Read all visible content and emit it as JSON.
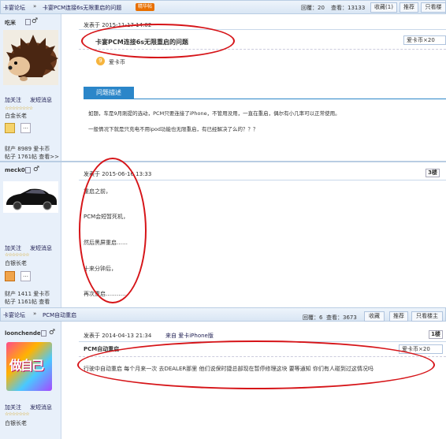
{
  "topbar": {
    "crumb1": "卡宴论坛",
    "sep": "»",
    "crumb2": "卡宴PCM连接6s无限重启的问题",
    "badge": "精华帖",
    "reply_label": "回覆：",
    "reply_count": "20",
    "view_label": "查看：",
    "view_count": "13133",
    "fav": "收藏(1)",
    "recommend": "推荐",
    "only_owner": "只看楼"
  },
  "post1": {
    "user": "吃米",
    "date": "发表于 2015-11-17 14:02",
    "title": "卡宴PCM连接6s无限重启的问题",
    "currency": "爱卡币×20",
    "coin": "9",
    "coin_label": "爱卡币",
    "section": "问题描述",
    "line1": "如题，车是9月刚提的选动，PCM只要连接了iPhone，不管用没用，一直在重启，偶尔有小几率可以正常使用。",
    "line2": "一般情况下就是只充电不用ipod功能也无限重启，有已经解决了么的？？？",
    "follow": "加关注",
    "msg": "发短消息",
    "rank": "白金长老",
    "money_label": "财产",
    "money": "8989 爱卡币",
    "posts_label": "帖子",
    "posts": "1761帖 查看>>",
    "stars": "☆☆☆☆☆☆☆☆"
  },
  "post2": {
    "user": "meck0",
    "date": "发表于 2015-06-16 13:33",
    "floor": "3楼",
    "follow": "加关注",
    "msg": "发短消息",
    "rank": "白银长老",
    "money_label": "财产",
    "money": "1411 爱卡币",
    "posts_label": "帖子",
    "posts": "1161帖 查看",
    "stars": "☆☆☆☆☆☆☆",
    "l1": "重启之前，",
    "l2": "PCM会短暂死机，",
    "l3": "然后黑屏重启……",
    "l4": "十来分钟后，",
    "l5": "再次重启…………"
  },
  "topbar2": {
    "crumb1": "卡宴论坛",
    "sep": "»",
    "crumb2": "PCM自动重启",
    "reply_label": "回覆：",
    "reply_count": "6",
    "view_label": "查看：",
    "view_count": "3673",
    "fav": "收藏",
    "recommend": "推荐",
    "only_owner": "只看楼主",
    "floor": "1楼"
  },
  "post3": {
    "user": "loonchende",
    "date": "发表于 2014-04-13 21:34",
    "from": "来自 爱卡iPhone版",
    "title": "PCM自动重启",
    "currency": "爱卡币×20",
    "text": "行驶中自动重启 每个月来一次 去DEALER那里 他们说保时捷总部现在暂停修理这块 要等通知 你们有人碰到过这情况吗",
    "avatar_text": "做自己",
    "follow": "加关注",
    "msg": "发短消息",
    "rank": "白银长老",
    "stars": "☆☆☆☆☆☆☆"
  },
  "colors": {
    "accent": "#2b86c9",
    "ellipse": "#d61418"
  }
}
